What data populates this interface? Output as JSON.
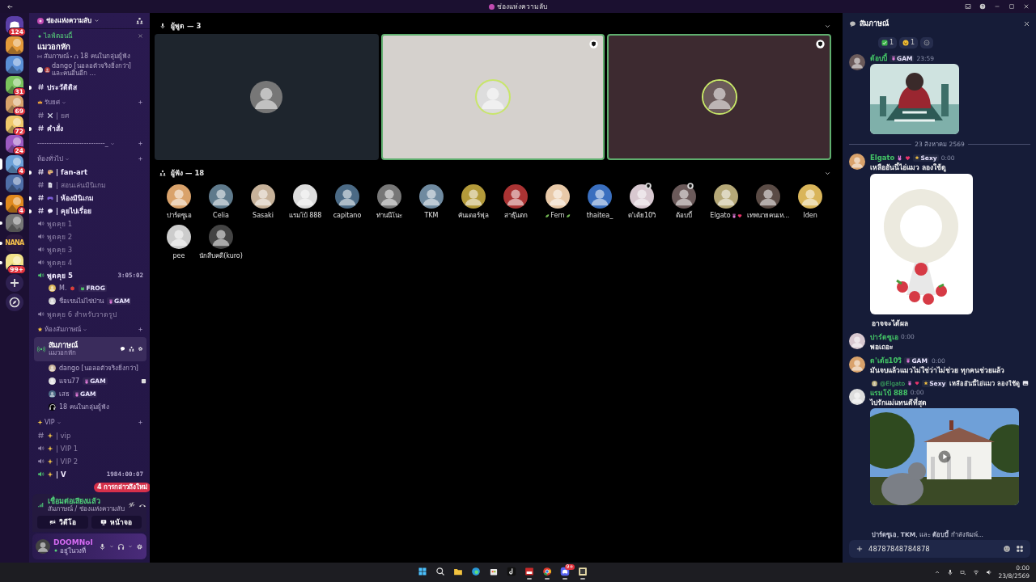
{
  "window": {
    "title": "ช่องแห่งความลับ"
  },
  "servers": [
    {
      "kind": "home",
      "badge": "124",
      "selected": false,
      "unread": false
    },
    {
      "kind": "server",
      "selected": false,
      "unread": false
    },
    {
      "kind": "server",
      "selected": false,
      "unread": false
    },
    {
      "kind": "server",
      "badge": "31",
      "selected": false,
      "unread": false
    },
    {
      "kind": "server",
      "badge": "69",
      "selected": false,
      "unread": false
    },
    {
      "kind": "server",
      "badge": "72",
      "selected": false,
      "unread": false
    },
    {
      "kind": "server",
      "badge": "24",
      "selected": false,
      "unread": false
    },
    {
      "kind": "server",
      "badge": "4",
      "selected": true,
      "unread": false
    },
    {
      "kind": "server",
      "selected": false,
      "unread": false
    },
    {
      "kind": "server",
      "badge": "4",
      "selected": false,
      "unread": true
    },
    {
      "kind": "server",
      "selected": false,
      "unread": true
    },
    {
      "kind": "server",
      "label": "NANA",
      "selected": false,
      "unread": true
    },
    {
      "kind": "server",
      "badge": "99+",
      "selected": false,
      "unread": true
    },
    {
      "kind": "add",
      "selected": false,
      "unread": false
    },
    {
      "kind": "discover",
      "selected": false,
      "unread": false
    }
  ],
  "sidebar": {
    "server_name": "ช่องแห่งความลับ",
    "event": {
      "status": "ไลฟ์ตอนนี้",
      "title": "แมวอกหัก",
      "stage": "สัมภาษณ์",
      "listeners": "18 คนในกลุ่มผู้ฟัง",
      "subtitle": "dango [นอลอตัวจริงยิ่งกว่า] และคนอื่นอีก ..."
    },
    "items": [
      {
        "kind": "text",
        "name": "ประวัติติส",
        "unread": true
      },
      {
        "kind": "category",
        "name": "รับยศ"
      },
      {
        "kind": "text",
        "name": "| ยศ",
        "unread": false
      },
      {
        "kind": "text",
        "name": "คำสั่ง",
        "unread": true
      },
      {
        "kind": "category",
        "name": "-----------------------------_"
      },
      {
        "kind": "category",
        "name": "ห้องทั่วไป"
      },
      {
        "kind": "text",
        "name": "| fan-art",
        "unread": true
      },
      {
        "kind": "text",
        "name": "| สอนเล่นมินิเกม",
        "unread": false
      },
      {
        "kind": "text",
        "name": "| ห้องมินิเกม",
        "unread": true
      },
      {
        "kind": "text",
        "name": "| คุยไปเรื่อย",
        "unread": true
      },
      {
        "kind": "voice",
        "name": "พูดคุย 1",
        "active": false
      },
      {
        "kind": "voice",
        "name": "พูดคุย 2",
        "active": false
      },
      {
        "kind": "voice",
        "name": "พูดคุย 3",
        "active": false
      },
      {
        "kind": "voice",
        "name": "พูดคุย 4",
        "active": false
      },
      {
        "kind": "voice",
        "name": "พูดคุย 5",
        "active": true,
        "time": "3:05:02"
      },
      {
        "kind": "member",
        "name": "M.",
        "tag": "FROG"
      },
      {
        "kind": "member",
        "name": "ชื่อเขนไม่ไข่ป่าน",
        "tag": "GAM"
      },
      {
        "kind": "voice",
        "name": "พูดคุย 6 สำหรับวาดรูป",
        "active": false
      },
      {
        "kind": "category",
        "name": "ห้องสัมภาษณ์"
      },
      {
        "kind": "stage",
        "name": "สัมภาษณ์",
        "subtitle": "แมวอกหัก",
        "selected": true
      },
      {
        "kind": "member",
        "name": "dango [นอลอตัวจริงยิ่งกว่า]"
      },
      {
        "kind": "member",
        "name": "แจน77",
        "tag": "GAM"
      },
      {
        "kind": "member",
        "name": "เสธ",
        "tag": "GAM"
      },
      {
        "kind": "listeners",
        "name": "18 คนในกลุ่มผู้ฟัง"
      },
      {
        "kind": "category",
        "name": "VIP"
      },
      {
        "kind": "text",
        "name": "| vip",
        "unread": false
      },
      {
        "kind": "voice",
        "name": "| VIP 1",
        "active": false
      },
      {
        "kind": "voice",
        "name": "| VIP 2",
        "active": false
      },
      {
        "kind": "voice",
        "name": "| V",
        "active": true,
        "time": "1984:00:07"
      }
    ],
    "mentions_pill": "4 การกล่าวถึงใหม่",
    "voice_panel": {
      "status": "เชื่อมต่อเสียงแล้ว",
      "location": "สัมภาษณ์ / ช่องแห่งความลับ",
      "buttons": [
        "วิดีโอ",
        "หน้าจอ"
      ]
    },
    "user": {
      "name": "DOOMNoI",
      "status": "อยู่ในวงที่"
    }
  },
  "stage": {
    "speakers_header": "ผู้พูด — 3",
    "speakers": [
      {
        "color": "#1e252d",
        "speaking": false,
        "moderator": false
      },
      {
        "color": "#d5d1cd",
        "speaking": true,
        "moderator": true
      },
      {
        "color": "#3d2a30",
        "speaking": true,
        "moderator": true
      }
    ],
    "audience_header": "ผู้ฟัง — 18",
    "audience": [
      {
        "name": "ปาร์ดซูเอ",
        "moderator": false
      },
      {
        "name": "Celia",
        "moderator": false
      },
      {
        "name": "Sasaki",
        "moderator": false
      },
      {
        "name": "แรมโบ้ 888",
        "moderator": false
      },
      {
        "name": "capitano",
        "moderator": false
      },
      {
        "name": "ท่านนีโนะ",
        "moderator": false
      },
      {
        "name": "TKM",
        "moderator": false
      },
      {
        "name": "คันเดอร์ฟุล",
        "moderator": false
      },
      {
        "name": "สาธุ๊แตก",
        "moderator": false
      },
      {
        "name": "Fern",
        "moderator": false
      },
      {
        "name": "thaitea_",
        "moderator": false
      },
      {
        "name": "ด'เด้ย10วิ",
        "moderator": true
      },
      {
        "name": "ต้อบบี้",
        "moderator": true
      },
      {
        "name": "Elgato",
        "moderator": false
      },
      {
        "name": "เทพนายคนเห...",
        "moderator": false
      },
      {
        "name": "Iden",
        "moderator": false
      },
      {
        "name": "pee",
        "moderator": false
      },
      {
        "name": "นักสืบคดี(kuro)",
        "moderator": false
      }
    ]
  },
  "chat": {
    "title": "สัมภาษณ์",
    "reactions": [
      {
        "count": "1"
      },
      {
        "count": "1"
      }
    ],
    "messages": [
      {
        "kind": "message",
        "author": "ต้อบบี้",
        "tag": "GAM",
        "time": "23:59",
        "attachment": {
          "kind": "picture"
        }
      },
      {
        "kind": "divider",
        "text": "23 สิงหาคม 2569"
      },
      {
        "kind": "message",
        "author": "Elgato",
        "decorated": true,
        "tag": "Sexy",
        "time": "0:00",
        "text": "เหลืออันนี้ไอ่แมว ลองใช้ดู",
        "attachment": {
          "kind": "picture"
        }
      },
      {
        "kind": "continuation",
        "text": "อาจจะได้ผล"
      },
      {
        "kind": "message",
        "author": "ปาร์ดซูเอ",
        "time": "0:00",
        "text": "พอเถอะ"
      },
      {
        "kind": "message",
        "author": "ด'เด้ย10วิ",
        "tag": "GAM",
        "time": "0:00",
        "text": "มันจบแล้วแมวไม่ใช่ว่าไม่ช่วย ทุกคนช่วยแล้ว"
      },
      {
        "kind": "message",
        "reply": {
          "author": "@Elgato",
          "tag": "Sexy",
          "text": "เหลืออันนี้ไอ่แมว ลองใช้ดู"
        },
        "author": "แรมโบ้ 888",
        "time": "0:00",
        "text": "ไปรักแม่แทนดีที่สุด",
        "attachment": {
          "kind": "picture",
          "play_button": true
        }
      }
    ],
    "typing": "**ปาร์ดซูเอ**, **TKM**, และ **ต้อบบี้** กำลังพิมพ์...",
    "input": {
      "value": "48787848784878"
    }
  },
  "taskbar": {
    "apps": [
      {
        "running": false
      },
      {
        "running": false
      },
      {
        "running": false
      },
      {
        "running": false
      },
      {
        "running": false
      },
      {
        "running": false
      },
      {
        "running": true
      },
      {
        "running": true
      },
      {
        "running": true,
        "badge": "9+"
      },
      {
        "running": true
      }
    ],
    "time": "0:00",
    "date": "23/8/2569"
  }
}
